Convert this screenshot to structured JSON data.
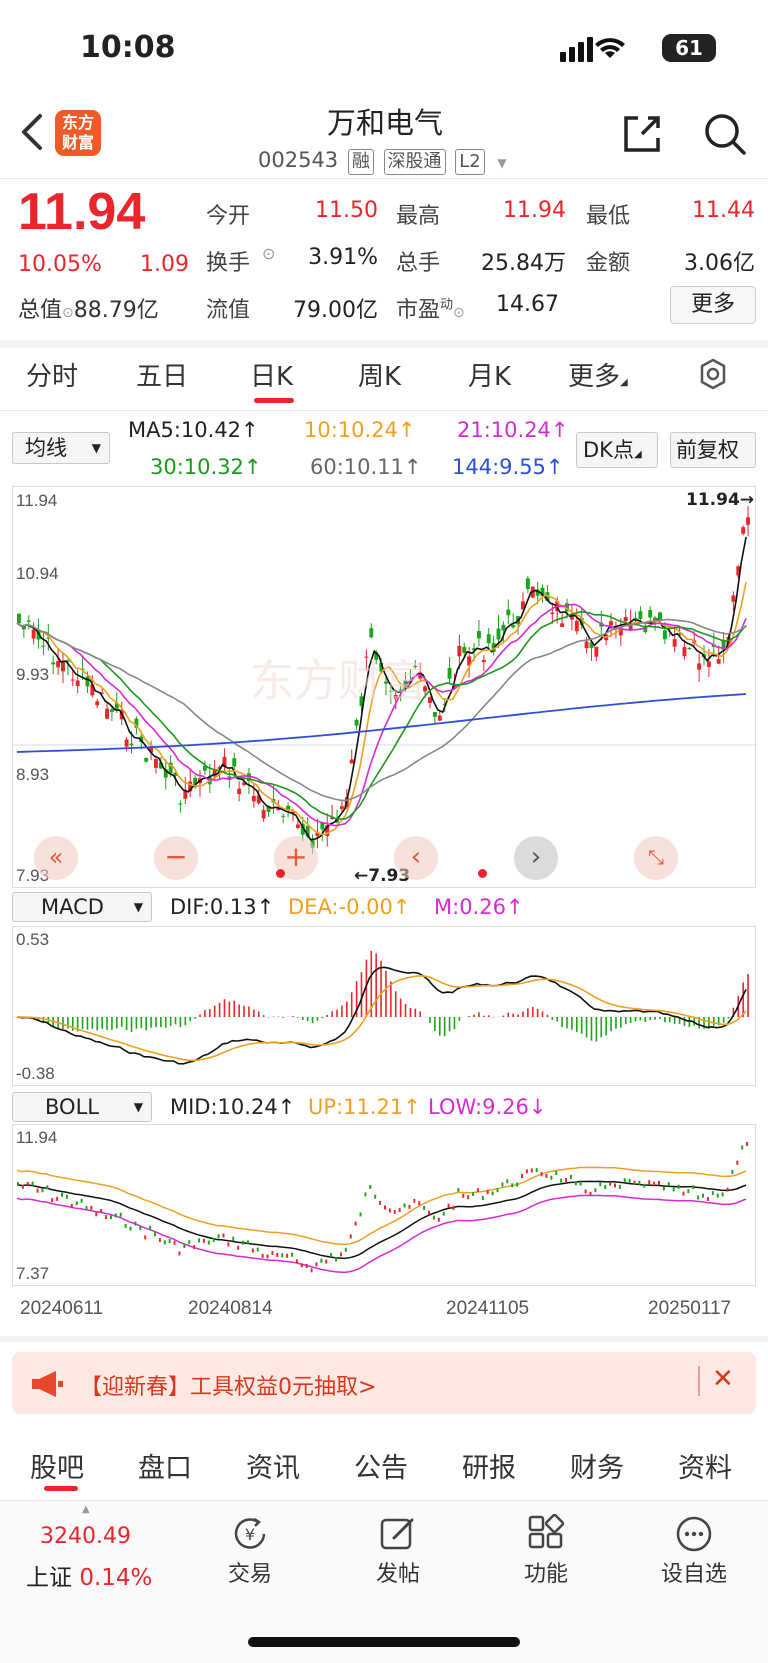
{
  "status": {
    "time": "10:08",
    "battery": "61"
  },
  "header": {
    "logo_line1": "东方",
    "logo_line2": "财富",
    "name": "万和电气",
    "code": "002543",
    "tags": [
      "融",
      "深股通",
      "L2"
    ]
  },
  "quote": {
    "price": "11.94",
    "change_pct": "10.05%",
    "change": "1.09",
    "total_value_label": "总值",
    "total_value": "88.79亿",
    "stats": [
      {
        "label": "今开",
        "value": "11.50",
        "color": "#e8262b"
      },
      {
        "label": "最高",
        "value": "11.94",
        "color": "#e8262b"
      },
      {
        "label": "最低",
        "value": "11.44",
        "color": "#e8262b"
      },
      {
        "label": "换手",
        "value": "3.91%",
        "color": "#222222"
      },
      {
        "label": "总手",
        "value": "25.84万",
        "color": "#222222"
      },
      {
        "label": "金额",
        "value": "3.06亿",
        "color": "#222222"
      },
      {
        "label": "流值",
        "value": "79.00亿",
        "color": "#222222"
      },
      {
        "label": "市盈",
        "value": "14.67",
        "color": "#222222"
      }
    ],
    "pe_sup": "动",
    "more": "更多"
  },
  "tabs": [
    "分时",
    "五日",
    "日K",
    "周K",
    "月K",
    "更多"
  ],
  "ma": {
    "selector": "均线",
    "ma5": "MA5:10.42↑",
    "ma10": "10:10.24↑",
    "ma21": "21:10.24↑",
    "ma30": "30:10.32↑",
    "ma60": "60:10.11↑",
    "ma144": "144:9.55↑",
    "dk": "DK点",
    "restore": "前复权"
  },
  "kline": {
    "y_labels": [
      "11.94",
      "10.94",
      "9.93",
      "8.93",
      "7.93"
    ],
    "high_marker": "11.94→",
    "low_marker": "←7.93",
    "watermark": "东方财富"
  },
  "macd": {
    "selector": "MACD",
    "dif": "DIF:0.13↑",
    "dea": "DEA:-0.00↑",
    "m": "M:0.26↑",
    "y_top": "0.53",
    "y_bottom": "-0.38"
  },
  "boll": {
    "selector": "BOLL",
    "mid": "MID:10.24↑",
    "up": "UP:11.21↑",
    "low": "LOW:9.26↓",
    "y_top": "11.94",
    "y_bottom": "7.37"
  },
  "dates": [
    "20240611",
    "20240814",
    "20241105",
    "20250117"
  ],
  "banner": {
    "text": "【迎新春】工具权益0元抽取>"
  },
  "bottom_tabs": [
    "股吧",
    "盘口",
    "资讯",
    "公告",
    "研报",
    "财务",
    "资料"
  ],
  "nav": {
    "index_value": "3240.49",
    "index_name": "上证",
    "index_pct": "0.14%",
    "items": [
      "交易",
      "发帖",
      "功能",
      "设自选"
    ]
  }
}
